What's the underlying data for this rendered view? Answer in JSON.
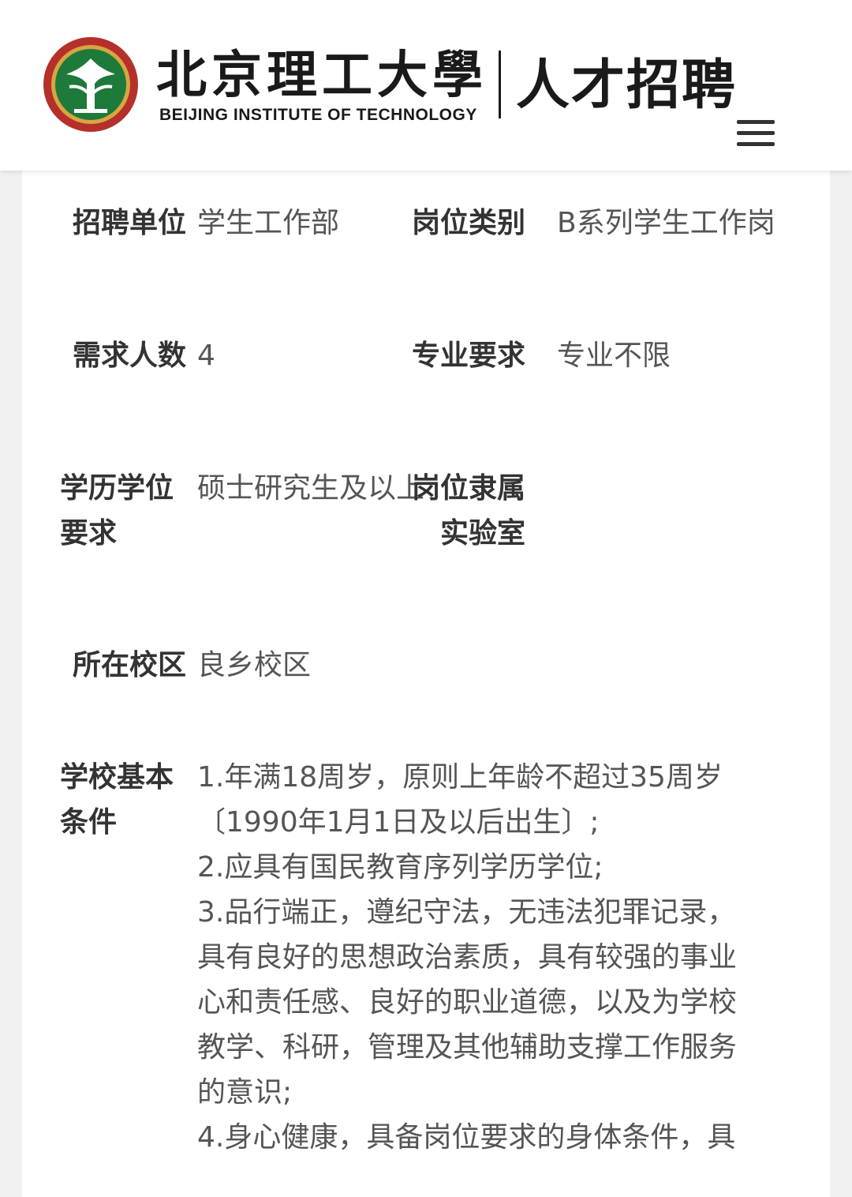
{
  "header": {
    "logo_title_cn": "北京理工大學",
    "logo_title_en": "BEIJING INSTITUTE OF TECHNOLOGY",
    "subtitle": "人才招聘",
    "menu_icon": "hamburger-menu-icon",
    "brand_colors": {
      "emblem_green": "#1e7a3a",
      "emblem_red": "#b5302a",
      "emblem_gold": "#d7a641"
    }
  },
  "fields": {
    "unit_label": "招聘单位",
    "unit_value": "学生工作部",
    "category_label": "岗位类别",
    "category_value": "B系列学生工作岗",
    "count_label": "需求人数",
    "count_value": "4",
    "major_label": "专业要求",
    "major_value": "专业不限",
    "degree_label": "学历学位要求",
    "degree_value": "硕士研究生及以上",
    "lab_label": "岗位隶属实验室",
    "lab_value": "",
    "campus_label": "所在校区",
    "campus_value": "良乡校区",
    "basic_label": "学校基本条件",
    "basic_lines": [
      "1.年满18周岁，原则上年龄不超过35周岁",
      "〔1990年1月1日及以后出生〕;",
      "2.应具有国民教育序列学历学位;",
      "3.品行端正，遵纪守法，无违法犯罪记录，",
      "具有良好的思想政治素质，具有较强的事业",
      "心和责任感、良好的职业道德，以及为学校",
      "教学、科研，管理及其他辅助支撑工作服务",
      "的意识;",
      "4.身心健康，具备岗位要求的身体条件，具"
    ]
  }
}
